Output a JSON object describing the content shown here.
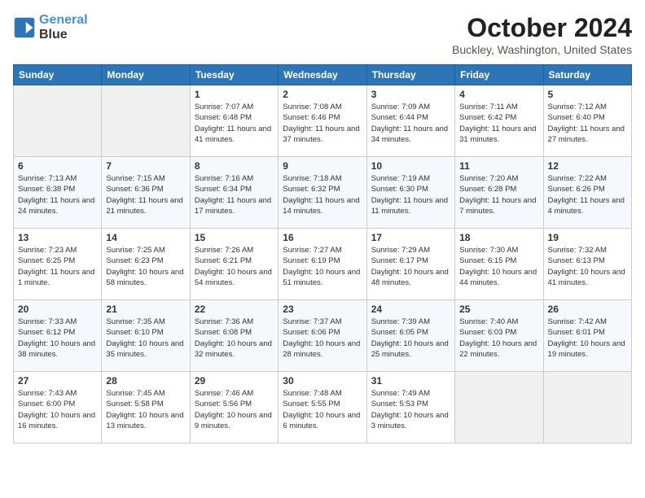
{
  "header": {
    "logo_line1": "General",
    "logo_line2": "Blue",
    "title": "October 2024",
    "subtitle": "Buckley, Washington, United States"
  },
  "weekdays": [
    "Sunday",
    "Monday",
    "Tuesday",
    "Wednesday",
    "Thursday",
    "Friday",
    "Saturday"
  ],
  "weeks": [
    [
      null,
      null,
      {
        "day": 1,
        "sunrise": "7:07 AM",
        "sunset": "6:48 PM",
        "daylight": "11 hours and 41 minutes."
      },
      {
        "day": 2,
        "sunrise": "7:08 AM",
        "sunset": "6:46 PM",
        "daylight": "11 hours and 37 minutes."
      },
      {
        "day": 3,
        "sunrise": "7:09 AM",
        "sunset": "6:44 PM",
        "daylight": "11 hours and 34 minutes."
      },
      {
        "day": 4,
        "sunrise": "7:11 AM",
        "sunset": "6:42 PM",
        "daylight": "11 hours and 31 minutes."
      },
      {
        "day": 5,
        "sunrise": "7:12 AM",
        "sunset": "6:40 PM",
        "daylight": "11 hours and 27 minutes."
      }
    ],
    [
      {
        "day": 6,
        "sunrise": "7:13 AM",
        "sunset": "6:38 PM",
        "daylight": "11 hours and 24 minutes."
      },
      {
        "day": 7,
        "sunrise": "7:15 AM",
        "sunset": "6:36 PM",
        "daylight": "11 hours and 21 minutes."
      },
      {
        "day": 8,
        "sunrise": "7:16 AM",
        "sunset": "6:34 PM",
        "daylight": "11 hours and 17 minutes."
      },
      {
        "day": 9,
        "sunrise": "7:18 AM",
        "sunset": "6:32 PM",
        "daylight": "11 hours and 14 minutes."
      },
      {
        "day": 10,
        "sunrise": "7:19 AM",
        "sunset": "6:30 PM",
        "daylight": "11 hours and 11 minutes."
      },
      {
        "day": 11,
        "sunrise": "7:20 AM",
        "sunset": "6:28 PM",
        "daylight": "11 hours and 7 minutes."
      },
      {
        "day": 12,
        "sunrise": "7:22 AM",
        "sunset": "6:26 PM",
        "daylight": "11 hours and 4 minutes."
      }
    ],
    [
      {
        "day": 13,
        "sunrise": "7:23 AM",
        "sunset": "6:25 PM",
        "daylight": "11 hours and 1 minute."
      },
      {
        "day": 14,
        "sunrise": "7:25 AM",
        "sunset": "6:23 PM",
        "daylight": "10 hours and 58 minutes."
      },
      {
        "day": 15,
        "sunrise": "7:26 AM",
        "sunset": "6:21 PM",
        "daylight": "10 hours and 54 minutes."
      },
      {
        "day": 16,
        "sunrise": "7:27 AM",
        "sunset": "6:19 PM",
        "daylight": "10 hours and 51 minutes."
      },
      {
        "day": 17,
        "sunrise": "7:29 AM",
        "sunset": "6:17 PM",
        "daylight": "10 hours and 48 minutes."
      },
      {
        "day": 18,
        "sunrise": "7:30 AM",
        "sunset": "6:15 PM",
        "daylight": "10 hours and 44 minutes."
      },
      {
        "day": 19,
        "sunrise": "7:32 AM",
        "sunset": "6:13 PM",
        "daylight": "10 hours and 41 minutes."
      }
    ],
    [
      {
        "day": 20,
        "sunrise": "7:33 AM",
        "sunset": "6:12 PM",
        "daylight": "10 hours and 38 minutes."
      },
      {
        "day": 21,
        "sunrise": "7:35 AM",
        "sunset": "6:10 PM",
        "daylight": "10 hours and 35 minutes."
      },
      {
        "day": 22,
        "sunrise": "7:36 AM",
        "sunset": "6:08 PM",
        "daylight": "10 hours and 32 minutes."
      },
      {
        "day": 23,
        "sunrise": "7:37 AM",
        "sunset": "6:06 PM",
        "daylight": "10 hours and 28 minutes."
      },
      {
        "day": 24,
        "sunrise": "7:39 AM",
        "sunset": "6:05 PM",
        "daylight": "10 hours and 25 minutes."
      },
      {
        "day": 25,
        "sunrise": "7:40 AM",
        "sunset": "6:03 PM",
        "daylight": "10 hours and 22 minutes."
      },
      {
        "day": 26,
        "sunrise": "7:42 AM",
        "sunset": "6:01 PM",
        "daylight": "10 hours and 19 minutes."
      }
    ],
    [
      {
        "day": 27,
        "sunrise": "7:43 AM",
        "sunset": "6:00 PM",
        "daylight": "10 hours and 16 minutes."
      },
      {
        "day": 28,
        "sunrise": "7:45 AM",
        "sunset": "5:58 PM",
        "daylight": "10 hours and 13 minutes."
      },
      {
        "day": 29,
        "sunrise": "7:46 AM",
        "sunset": "5:56 PM",
        "daylight": "10 hours and 9 minutes."
      },
      {
        "day": 30,
        "sunrise": "7:48 AM",
        "sunset": "5:55 PM",
        "daylight": "10 hours and 6 minutes."
      },
      {
        "day": 31,
        "sunrise": "7:49 AM",
        "sunset": "5:53 PM",
        "daylight": "10 hours and 3 minutes."
      },
      null,
      null
    ]
  ]
}
